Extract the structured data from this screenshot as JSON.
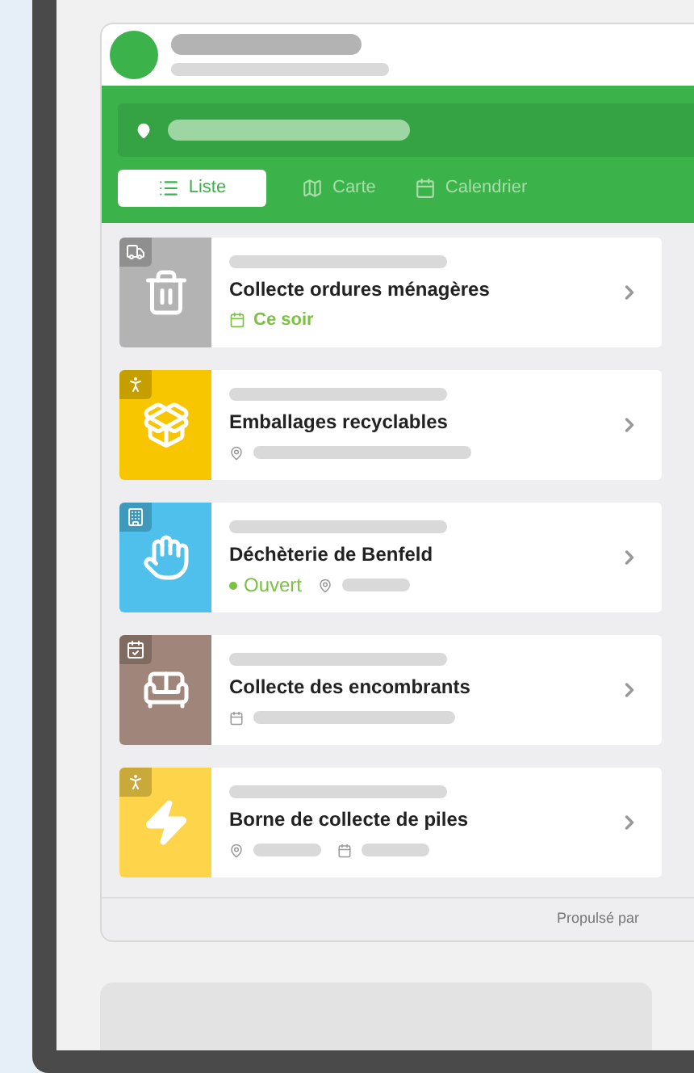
{
  "tabs": [
    {
      "label": "Liste",
      "kind": "list",
      "selected": true
    },
    {
      "label": "Carte",
      "kind": "map",
      "selected": false
    },
    {
      "label": "Calendrier",
      "kind": "calendar",
      "selected": false
    }
  ],
  "items": [
    {
      "kind": "trash",
      "color": "#b3b3b3",
      "title": "Collecte ordures ménagères",
      "meta": [
        {
          "kind": "date",
          "text": "Ce soir"
        }
      ]
    },
    {
      "kind": "packaging",
      "color": "#f7c600",
      "title": "Emballages recyclables",
      "meta": [
        {
          "kind": "location"
        }
      ]
    },
    {
      "kind": "center",
      "color": "#4fc0ec",
      "title": "Déchèterie de Benfeld",
      "meta": [
        {
          "kind": "status",
          "text": "Ouvert"
        },
        {
          "kind": "location"
        }
      ]
    },
    {
      "kind": "bulky",
      "color": "#a0867a",
      "title": "Collecte des encombrants",
      "meta": [
        {
          "kind": "calendar"
        }
      ]
    },
    {
      "kind": "battery",
      "color": "#fdd44a",
      "title": "Borne de collecte de piles",
      "meta": [
        {
          "kind": "location"
        },
        {
          "kind": "calendar"
        }
      ]
    }
  ],
  "footer": {
    "text": "Propulsé par"
  }
}
